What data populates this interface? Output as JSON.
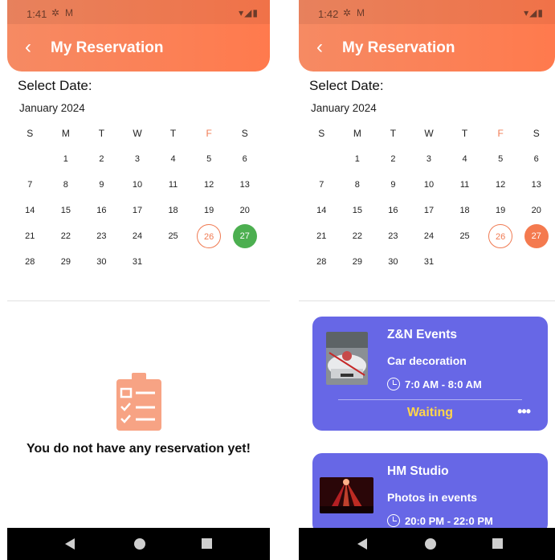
{
  "left": {
    "status_time": "1:41",
    "header_title": "My Reservation",
    "select_date_label": "Select Date:",
    "month": "January 2024",
    "weekdays": [
      "S",
      "M",
      "T",
      "W",
      "T",
      "F",
      "S"
    ],
    "weeks": [
      [
        "",
        "1",
        "2",
        "3",
        "4",
        "5",
        "6"
      ],
      [
        "7",
        "8",
        "9",
        "10",
        "11",
        "12",
        "13"
      ],
      [
        "14",
        "15",
        "16",
        "17",
        "18",
        "19",
        "20"
      ],
      [
        "21",
        "22",
        "23",
        "24",
        "25",
        "26",
        "27"
      ],
      [
        "28",
        "29",
        "30",
        "31",
        "",
        "",
        ""
      ]
    ],
    "today": "26",
    "selected": "27",
    "selected_color": "#4caf50",
    "empty_message": "You do not have any reservation yet!"
  },
  "right": {
    "status_time": "1:42",
    "header_title": "My Reservation",
    "select_date_label": "Select Date:",
    "month": "January 2024",
    "weekdays": [
      "S",
      "M",
      "T",
      "W",
      "T",
      "F",
      "S"
    ],
    "weeks": [
      [
        "",
        "1",
        "2",
        "3",
        "4",
        "5",
        "6"
      ],
      [
        "7",
        "8",
        "9",
        "10",
        "11",
        "12",
        "13"
      ],
      [
        "14",
        "15",
        "16",
        "17",
        "18",
        "19",
        "20"
      ],
      [
        "21",
        "22",
        "23",
        "24",
        "25",
        "26",
        "27"
      ],
      [
        "28",
        "29",
        "30",
        "31",
        "",
        "",
        ""
      ]
    ],
    "today": "26",
    "selected": "27",
    "selected_color": "#f47a4f",
    "reservations": [
      {
        "name": "Z&N Events",
        "service": "Car decoration",
        "time": "7:0 AM - 8:0 AM",
        "status": "Waiting"
      },
      {
        "name": "HM Studio",
        "service": "Photos in events",
        "time": "20:0 PM - 22:0 PM"
      }
    ]
  },
  "colors": {
    "header": "#ff7a4d",
    "card": "#6767e6",
    "status_waiting": "#ffd54a",
    "friday": "#f07a52"
  }
}
